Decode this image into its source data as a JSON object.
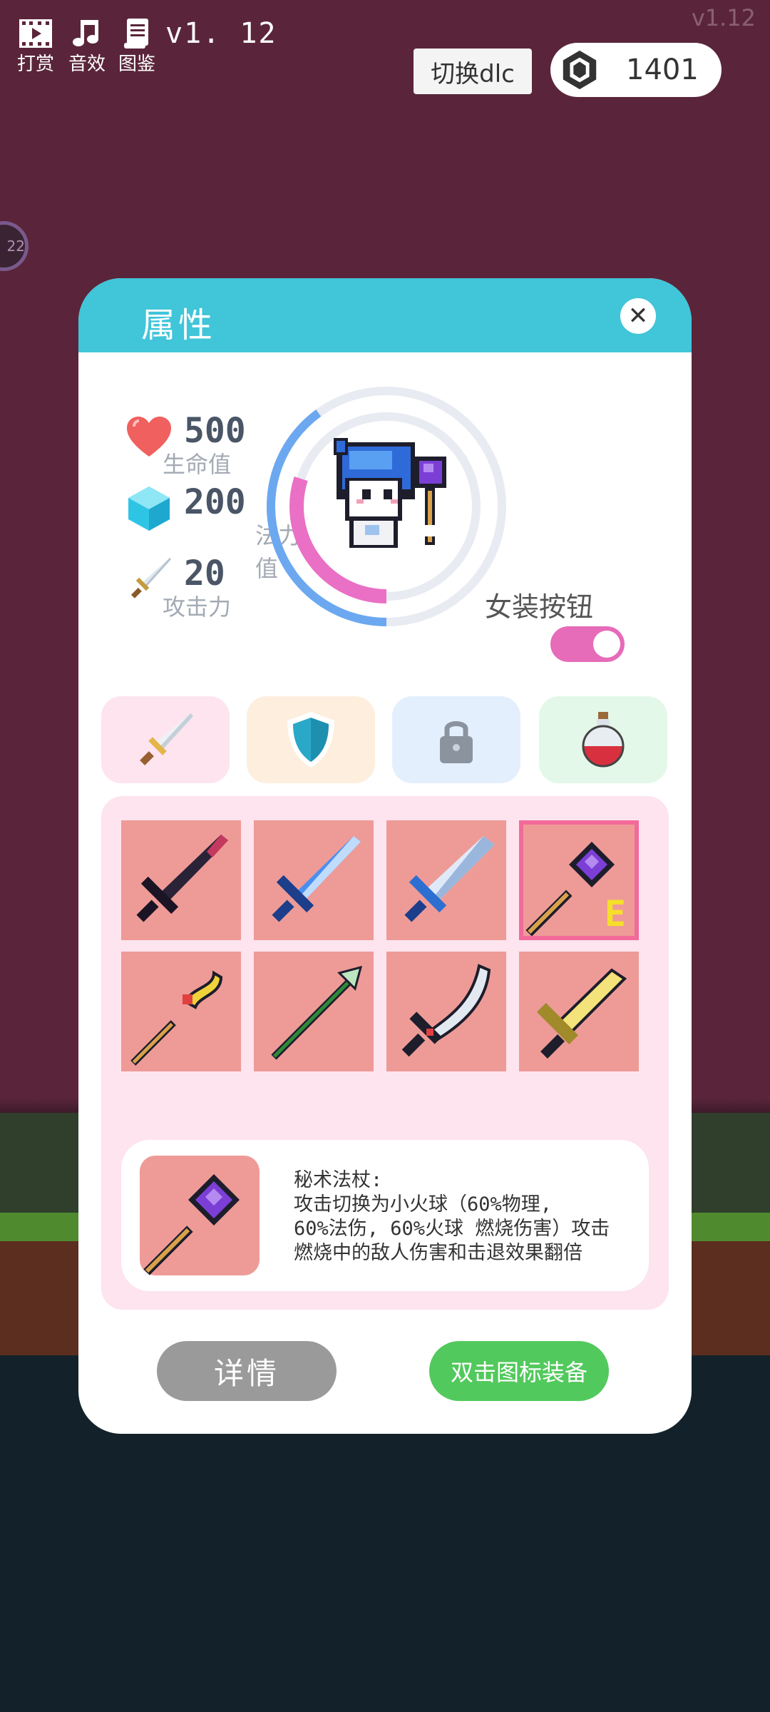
{
  "topbar": {
    "reward_label": "打赏",
    "sound_label": "音效",
    "codex_label": "图鉴",
    "version": "v1. 12",
    "version_corner": "v1.12",
    "dlc_button": "切换dlc",
    "gem_count": "1401",
    "side_badge": "22"
  },
  "dialog": {
    "title": "属性",
    "close_icon": "close-icon"
  },
  "stats": {
    "hp_value": "500",
    "hp_label": "生命值",
    "mp_value": "200",
    "mp_label": "法力值",
    "atk_value": "20",
    "atk_label": "攻击力"
  },
  "portrait": {
    "ring_blue_fraction": 0.4,
    "ring_pink_fraction": 0.3
  },
  "toggle": {
    "label": "女装按钮",
    "on": true
  },
  "tabs": [
    {
      "icon": "sword-icon",
      "color": "#fde4ee"
    },
    {
      "icon": "shield-icon",
      "color": "#fdeede"
    },
    {
      "icon": "lock-icon",
      "color": "#e4effd"
    },
    {
      "icon": "potion-icon",
      "color": "#e3f8e8"
    }
  ],
  "inventory": {
    "items": [
      {
        "icon": "dark-sword-icon"
      },
      {
        "icon": "blue-sword-icon"
      },
      {
        "icon": "ice-sword-icon"
      },
      {
        "icon": "arcane-staff-icon",
        "equipped": true
      },
      {
        "icon": "golden-crook-staff-icon"
      },
      {
        "icon": "green-trident-staff-icon"
      },
      {
        "icon": "curved-blade-icon"
      },
      {
        "icon": "golden-sword-icon"
      }
    ],
    "equipped_mark": "E"
  },
  "description": {
    "line1": "秘术法杖:",
    "line2": "攻击切换为小火球（60%物理,",
    "line3": "60%法伤, 60%火球 燃烧伤害）攻击",
    "line4": "燃烧中的敌人伤害和击退效果翻倍"
  },
  "buttons": {
    "detail": "详情",
    "equip": "双击图标装备"
  },
  "colors": {
    "header": "#40c5d9",
    "accent_pink": "#e66bb8",
    "slot": "#ee9b97",
    "equip_green": "#52c95c"
  }
}
